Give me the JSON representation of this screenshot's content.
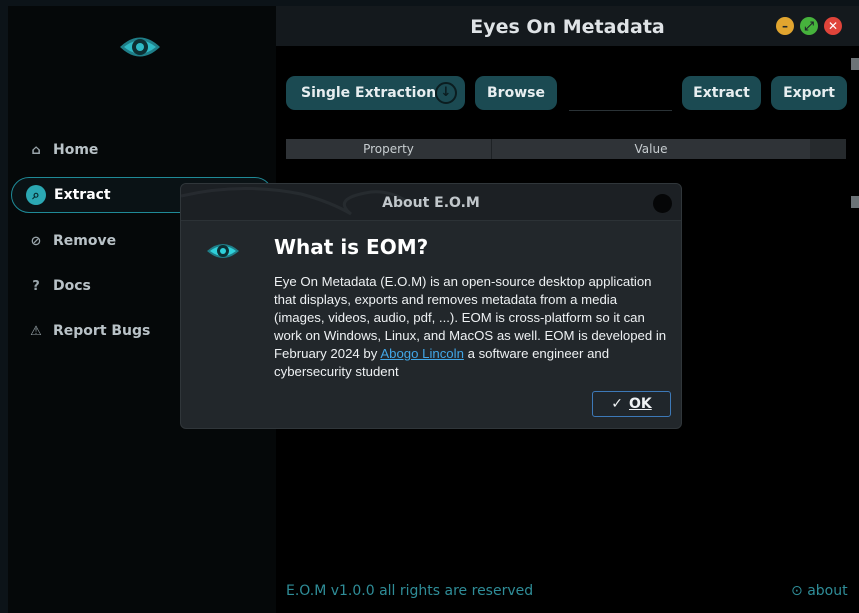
{
  "window": {
    "title": "Eyes On Metadata",
    "controls": [
      "minimize",
      "maximize",
      "close"
    ]
  },
  "sidebar": {
    "logo": "eye-logo",
    "items": [
      {
        "label": "Home",
        "icon": "home-icon"
      },
      {
        "label": "Extract",
        "icon": "search-icon",
        "active": true
      },
      {
        "label": "Remove",
        "icon": "remove-tag-icon"
      },
      {
        "label": "Docs",
        "icon": "help-circle-icon"
      },
      {
        "label": "Report Bugs",
        "icon": "warning-icon"
      }
    ]
  },
  "toolbar": {
    "mode_label": "Single Extraction",
    "browse_label": "Browse",
    "extract_label": "Extract",
    "export_label": "Export"
  },
  "table": {
    "headers": [
      "Property",
      "Value"
    ]
  },
  "footer": {
    "copyright": "E.O.M v1.0.0 all rights are reserved",
    "about_label": "about",
    "about_glyph": "⊙"
  },
  "dialog": {
    "title": "About E.O.M",
    "heading": "What is EOM?",
    "body_before_link": "Eye On Metadata (E.O.M) is an open-source desktop application that displays, exports and removes metadata from a media (images, videos, audio, pdf, ...). EOM is cross-platform so it can work on Windows, Linux, and MacOS as well. EOM is developed in February 2024 by ",
    "link_text": "Abogo Lincoln",
    "body_after_link": " a software engineer and cybersecurity student",
    "ok_label": "OK",
    "ok_glyph": "✓"
  },
  "colors": {
    "accent": "#1b4a52",
    "accent_bright": "#2ba8b3",
    "link": "#41a6e6",
    "footer": "#2f8d98"
  },
  "glyphs": {
    "home": "⌂",
    "search": "⌕",
    "remove": "⊘",
    "docs": "?",
    "report": "⚠",
    "dropdown": "↓",
    "minimize": "–",
    "maximize": "⤢",
    "close": "✕"
  }
}
